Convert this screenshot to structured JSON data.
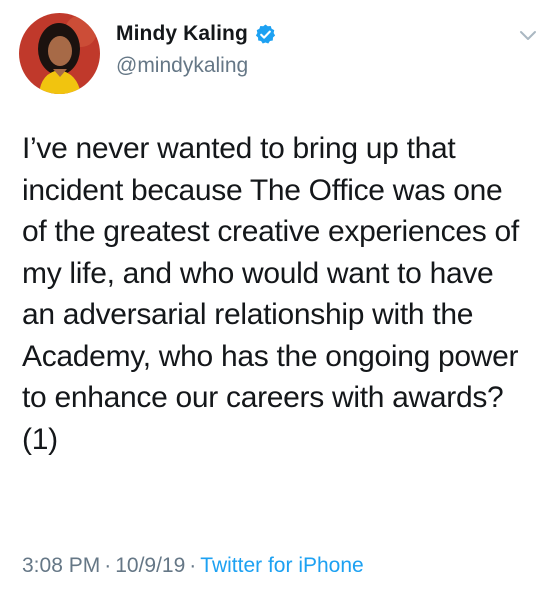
{
  "author": {
    "display_name": "Mindy Kaling",
    "handle": "@mindykaling",
    "verified": true
  },
  "tweet": {
    "text_lines": [
      "I’ve never wanted to bring up that",
      "incident because The Office was one",
      "of the greatest creative experiences of",
      "my life, and who would want to have",
      "an adversarial relationship with the",
      "Academy, who has the ongoing power",
      "to enhance our careers with awards?",
      "(1)"
    ],
    "time": "3:08 PM",
    "date": "10/9/19",
    "separator": "·",
    "source": "Twitter for iPhone"
  },
  "icons": {
    "verified": "verified-badge-icon",
    "menu": "chevron-down-icon"
  },
  "colors": {
    "text": "#14171a",
    "secondary": "#657786",
    "link": "#1da1f2",
    "avatar_bg": "#c0392b"
  }
}
